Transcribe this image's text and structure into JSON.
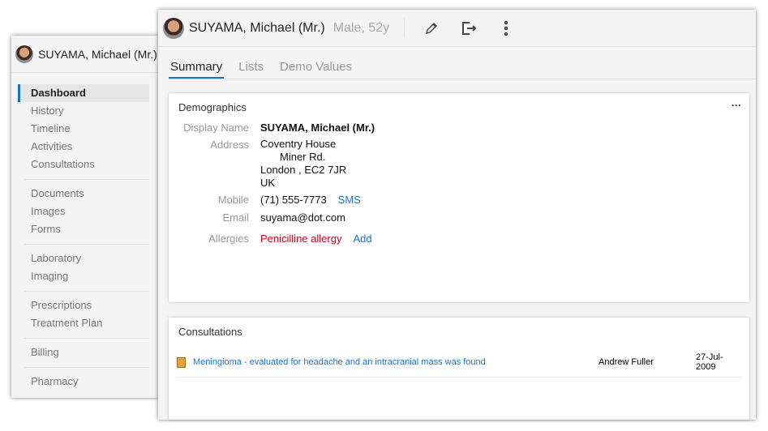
{
  "sidebar": {
    "patient_name": "SUYAMA, Michael (Mr.)",
    "groups": [
      [
        "Dashboard",
        "History",
        "Timeline",
        "Activities",
        "Consultations"
      ],
      [
        "Documents",
        "Images",
        "Forms"
      ],
      [
        "Laboratory",
        "Imaging"
      ],
      [
        "Prescriptions",
        "Treatment Plan"
      ],
      [
        "Billing"
      ],
      [
        "Pharmacy"
      ]
    ],
    "active": "Dashboard"
  },
  "header": {
    "patient_name": "SUYAMA, Michael (Mr.)",
    "sex_age": "Male, 52y",
    "icons": [
      "pencil-icon",
      "logout-icon",
      "more-vertical-icon"
    ]
  },
  "tabs": [
    "Summary",
    "Lists",
    "Demo Values"
  ],
  "demographics": {
    "title": "Demographics",
    "menu": "···",
    "display_name_label": "Display Name",
    "display_name": "SUYAMA, Michael (Mr.)",
    "address_label": "Address",
    "address": [
      "Coventry House",
      "Miner Rd.",
      "London , EC2 7JR",
      "UK"
    ],
    "mobile_label": "Mobile",
    "mobile": "(71) 555-7773",
    "sms": "SMS",
    "email_label": "Email",
    "email": "suyama@dot.com",
    "allergies_label": "Allergies",
    "allergy": "Penicilline allergy",
    "add": "Add"
  },
  "consultations": {
    "title": "Consultations",
    "items": [
      {
        "text": "Meningioma - evaluated for headache and an intracranial mass was found",
        "doctor": "Andrew Fuller",
        "date": "27-Jul-2009"
      }
    ]
  },
  "colors": {
    "accent": "#1a73c9",
    "allergy": "#d0021b"
  }
}
